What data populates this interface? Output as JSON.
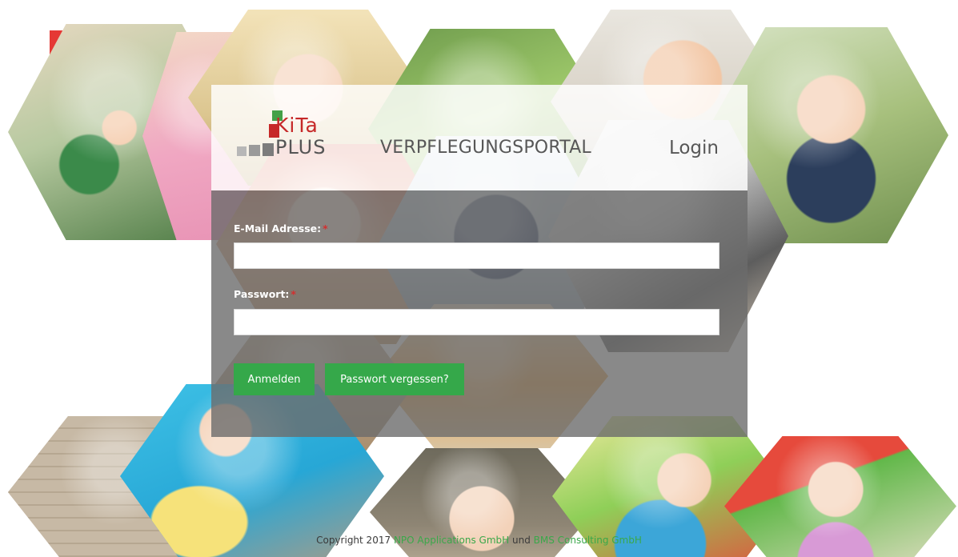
{
  "header": {
    "logo": {
      "line1": "KiTa",
      "line2": "PLUS"
    },
    "portal_title": "VERPFLEGUNGSPORTAL",
    "page_title": "Login"
  },
  "form": {
    "email": {
      "label": "E-Mail Adresse:",
      "required_mark": "*",
      "value": "",
      "placeholder": ""
    },
    "password": {
      "label": "Passwort:",
      "required_mark": "*",
      "value": "",
      "placeholder": ""
    },
    "buttons": {
      "login": "Anmelden",
      "forgot_password": "Passwort vergessen?"
    }
  },
  "footer": {
    "prefix": "Copyright 2017",
    "company1": "NPO Applications GmbH",
    "joiner": "und",
    "company2": "BMS Consulting GmbH"
  },
  "colors": {
    "accent_green": "#35a84a",
    "logo_red": "#c62828",
    "required_red": "#d32f2f"
  }
}
